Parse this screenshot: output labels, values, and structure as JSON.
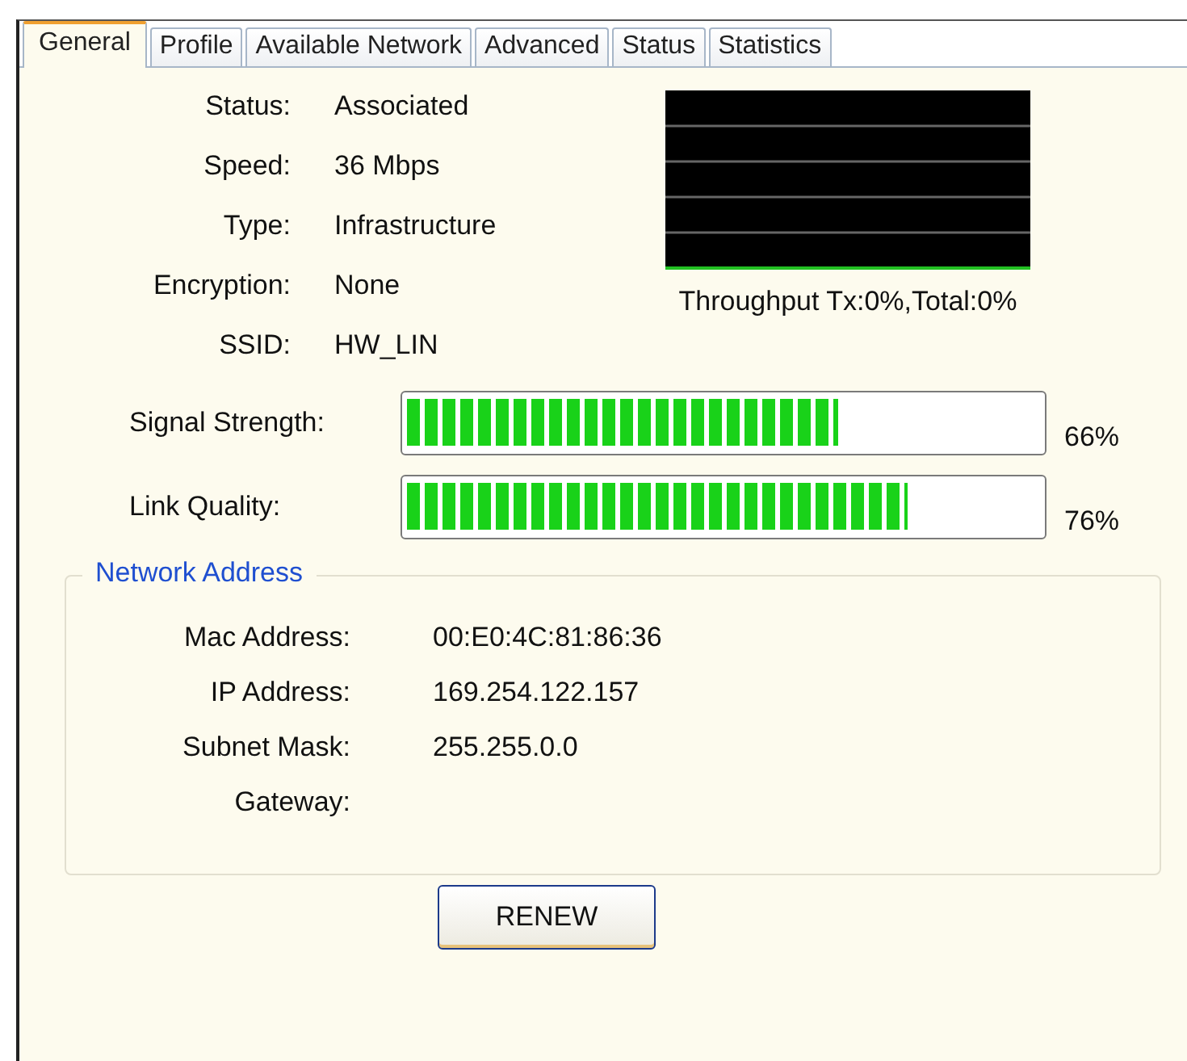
{
  "tabs": [
    {
      "label": "General",
      "selected": true
    },
    {
      "label": "Profile",
      "selected": false
    },
    {
      "label": "Available Network",
      "selected": false
    },
    {
      "label": "Advanced",
      "selected": false
    },
    {
      "label": "Status",
      "selected": false
    },
    {
      "label": "Statistics",
      "selected": false
    }
  ],
  "info": [
    {
      "label": "Status:",
      "value": "Associated"
    },
    {
      "label": "Speed:",
      "value": "36 Mbps"
    },
    {
      "label": "Type:",
      "value": "Infrastructure"
    },
    {
      "label": "Encryption:",
      "value": "None"
    },
    {
      "label": "SSID:",
      "value": "HW_LIN"
    }
  ],
  "throughput": {
    "caption": "Throughput Tx:0%,Total:0%"
  },
  "meters": [
    {
      "label": "Signal Strength:",
      "level": 0.68,
      "reading": "66%"
    },
    {
      "label": "Link Quality:",
      "level": 0.79,
      "reading": "76%"
    }
  ],
  "network_address": {
    "title": "Network Address",
    "rows": [
      {
        "label": "Mac Address:",
        "value": "00:E0:4C:81:86:36"
      },
      {
        "label": "IP Address:",
        "value": "169.254.122.157"
      },
      {
        "label": "Subnet Mask:",
        "value": "255.255.0.0"
      },
      {
        "label": "Gateway:",
        "value": ""
      }
    ]
  },
  "buttons": [
    {
      "label": "RENEW"
    }
  ]
}
